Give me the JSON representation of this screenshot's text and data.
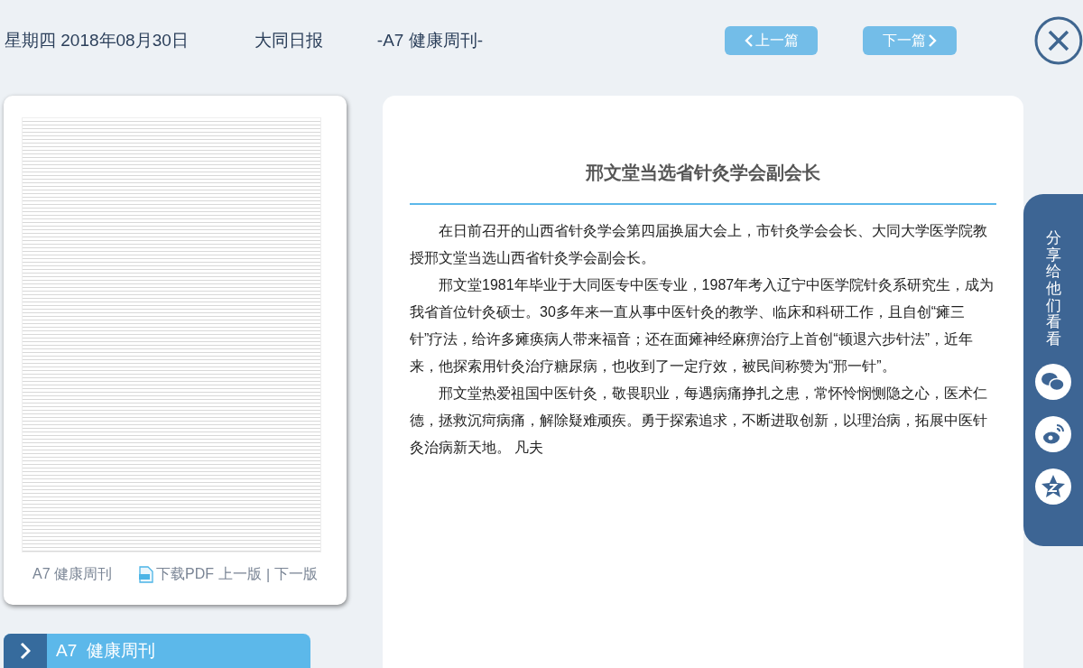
{
  "header": {
    "date": "星期四 2018年08月30日",
    "paper": "大同日报",
    "edition": "-A7 健康周刊-",
    "prev_button": "上一篇",
    "next_button": "下一篇"
  },
  "page_card": {
    "edition_label": "A7 健康周刊",
    "links": [
      {
        "kind": "pdf",
        "label": "下载PDF"
      },
      {
        "kind": "link",
        "label": "上一版"
      },
      {
        "kind": "separator",
        "label": "|"
      },
      {
        "kind": "link",
        "label": "下一版"
      }
    ]
  },
  "section_bar": {
    "label": "A7  健康周刊"
  },
  "article": {
    "title": "邢文堂当选省针灸学会副会长",
    "paragraphs": [
      "在日前召开的山西省针灸学会第四届换届大会上，市针灸学会会长、大同大学医学院教授邢文堂当选山西省针灸学会副会长。",
      "邢文堂1981年毕业于大同医专中医专业，1987年考入辽宁中医学院针灸系研究生，成为我省首位针灸硕士。30多年来一直从事中医针灸的教学、临床和科研工作，且自创“瘫三针”疗法，给许多瘫痪病人带来福音；还在面瘫神经麻痹治疗上首创“顿退六步针法”，近年来，他探索用针灸治疗糖尿病，也收到了一定疗效，被民间称赞为“邢一针”。",
      "邢文堂热爱祖国中医针灸，敬畏职业，每遇病痛挣扎之患，常怀怜悯恻隐之心，医术仁德，拯救沉疴病痛，解除疑难顽疾。勇于探索追求，不断进取创新，以理治病，拓展中医针灸治病新天地。 凡夫"
    ]
  },
  "share": {
    "label": "分享给他们看看"
  }
}
